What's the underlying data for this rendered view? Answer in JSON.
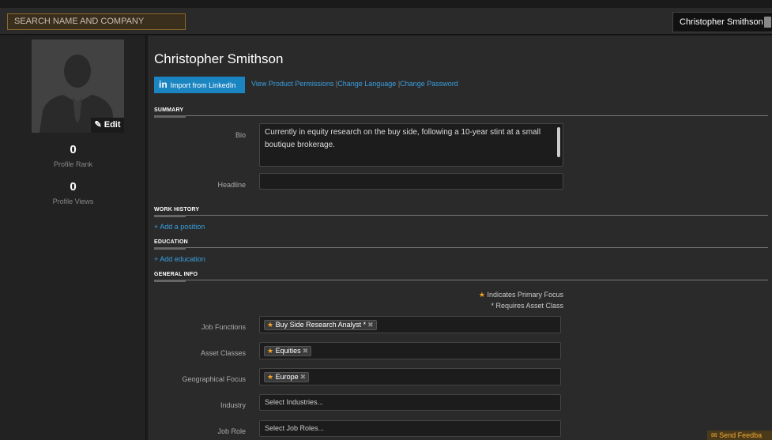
{
  "topbar": {
    "search_placeholder": "SEARCH NAME AND COMPANY",
    "user_name": "Christopher Smithson",
    "caret": "▾"
  },
  "left": {
    "edit_label": "Edit",
    "profile_rank": "0",
    "profile_rank_label": "Profile Rank",
    "profile_views": "0",
    "profile_views_label": "Profile Views"
  },
  "main": {
    "name": "Christopher Smithson",
    "linkedin_label": "Import from LinkedIn",
    "linkedin_logo": "in",
    "links": {
      "permissions": "View Product Permissions",
      "language": "Change Language",
      "password": "Change Password",
      "separator": "|"
    },
    "sections": {
      "summary": "SUMMARY",
      "work_history": "WORK HISTORY",
      "education": "EDUCATION",
      "general_info": "GENERAL INFO"
    },
    "summary": {
      "bio_label": "Bio",
      "bio_text": "Currently in equity research on the buy side, following a 10-year stint at a small boutique brokerage.",
      "headline_label": "Headline",
      "headline_value": ""
    },
    "add_position": "+ Add a position",
    "add_education": "+ Add education",
    "general": {
      "legend_primary": "Indicates Primary Focus",
      "legend_asset": "* Requires Asset Class",
      "job_functions_label": "Job Functions",
      "job_functions_tag": "Buy Side Research Analyst *",
      "asset_classes_label": "Asset Classes",
      "asset_classes_tag": "Equities",
      "geo_label": "Geographical Focus",
      "geo_tag": "Europe",
      "industry_label": "Industry",
      "industry_placeholder": "Select Industries...",
      "job_role_label": "Job Role",
      "job_role_placeholder": "Select Job Roles..."
    }
  },
  "feedback_label": "Send Feedba",
  "colors": {
    "accent_blue": "#3aa0e0",
    "linkedin_blue": "#1b85c1",
    "star_orange": "#f5a623"
  }
}
